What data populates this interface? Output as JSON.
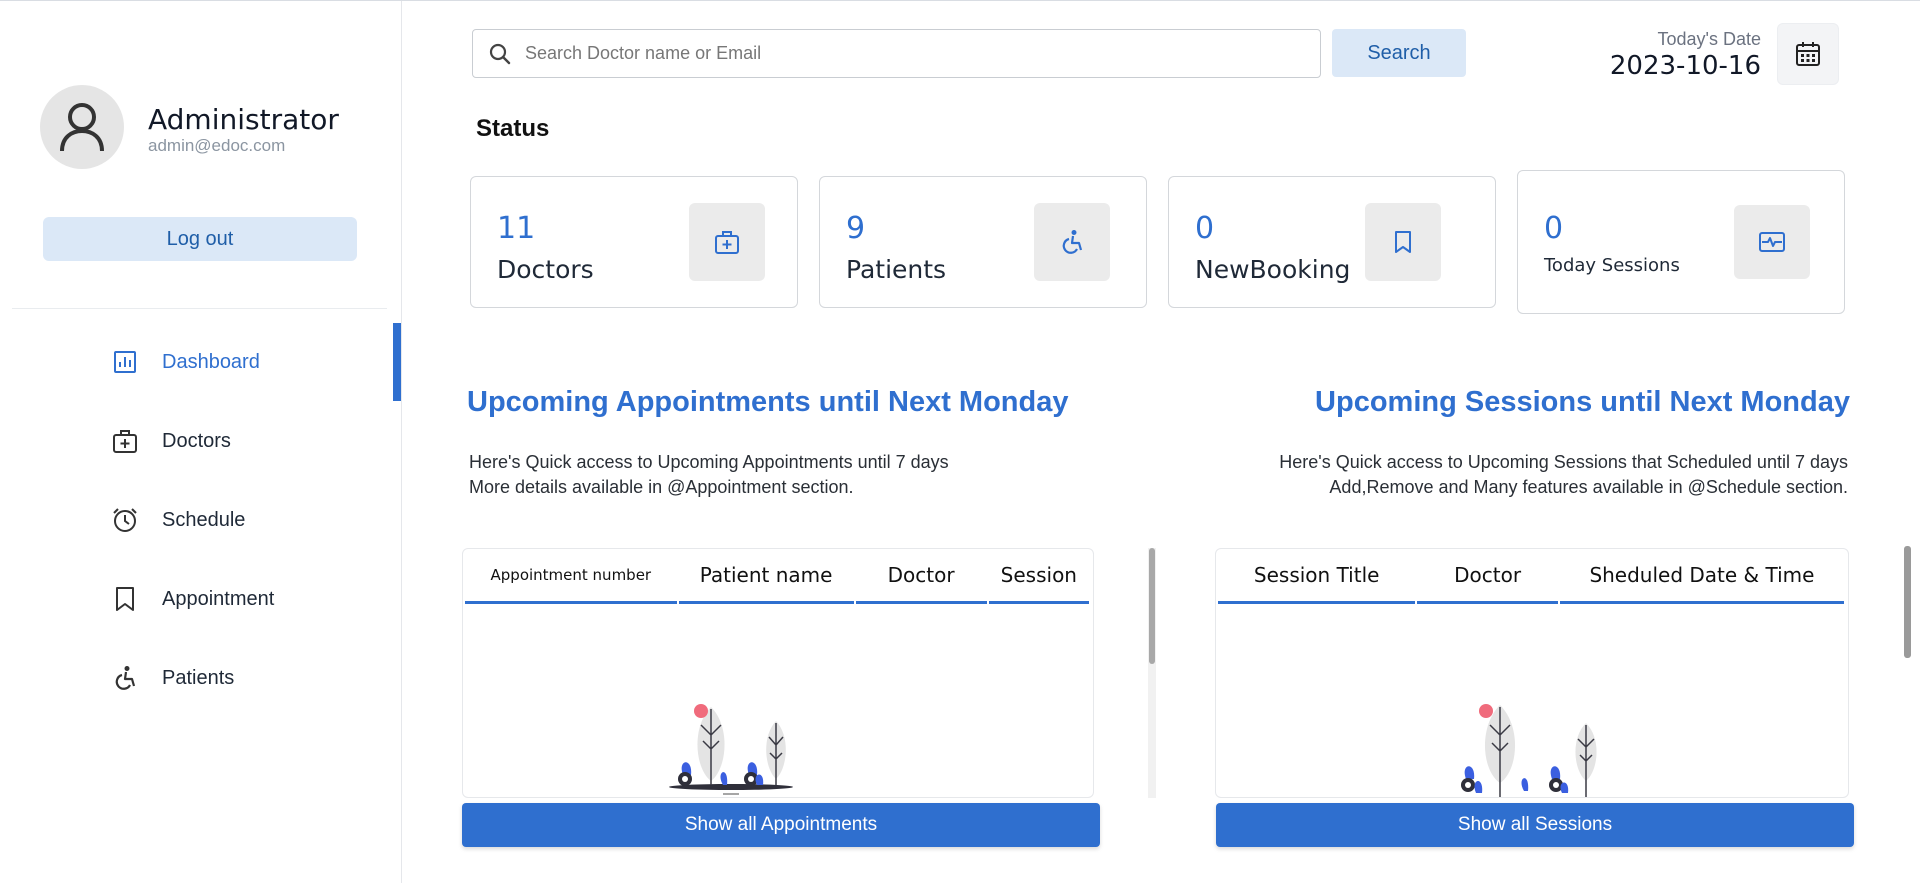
{
  "user": {
    "name": "Administrator",
    "email": "admin@edoc.com"
  },
  "sidebar": {
    "logout_label": "Log out",
    "items": [
      {
        "label": "Dashboard",
        "icon": "dashboard-icon",
        "active": true
      },
      {
        "label": "Doctors",
        "icon": "medical-kit-icon"
      },
      {
        "label": "Schedule",
        "icon": "alarm-clock-icon"
      },
      {
        "label": "Appointment",
        "icon": "bookmark-icon"
      },
      {
        "label": "Patients",
        "icon": "wheelchair-icon"
      }
    ]
  },
  "search": {
    "placeholder": "Search Doctor name or Email",
    "button_label": "Search"
  },
  "date": {
    "label": "Today's Date",
    "value": "2023-10-16"
  },
  "status": {
    "title": "Status",
    "cards": [
      {
        "value": "11",
        "label": "Doctors",
        "icon": "medical-kit-icon"
      },
      {
        "value": "9",
        "label": "Patients",
        "icon": "wheelchair-icon"
      },
      {
        "value": "0",
        "label": "NewBooking",
        "icon": "bookmark-icon"
      },
      {
        "value": "0",
        "label": "Today Sessions",
        "icon": "pulse-icon"
      }
    ]
  },
  "appointments": {
    "title": "Upcoming Appointments until Next Monday",
    "desc_line1": "Here's Quick access to Upcoming Appointments until 7 days",
    "desc_line2": "More details available in @Appointment section.",
    "columns": [
      "Appointment number",
      "Patient name",
      "Doctor",
      "Session"
    ],
    "button_label": "Show all Appointments"
  },
  "sessions": {
    "title": "Upcoming Sessions until Next Monday",
    "desc_line1": "Here's Quick access to Upcoming Sessions that Scheduled until 7 days",
    "desc_line2": "Add,Remove and Many features available in @Schedule section.",
    "columns": [
      "Session Title",
      "Doctor",
      "Sheduled Date & Time"
    ],
    "button_label": "Show all Sessions"
  },
  "colors": {
    "accent": "#2f6fcf",
    "accent_light": "#dbe8f7",
    "illustration_blue": "#3b5fe0",
    "illustration_pink": "#f06b7c"
  }
}
